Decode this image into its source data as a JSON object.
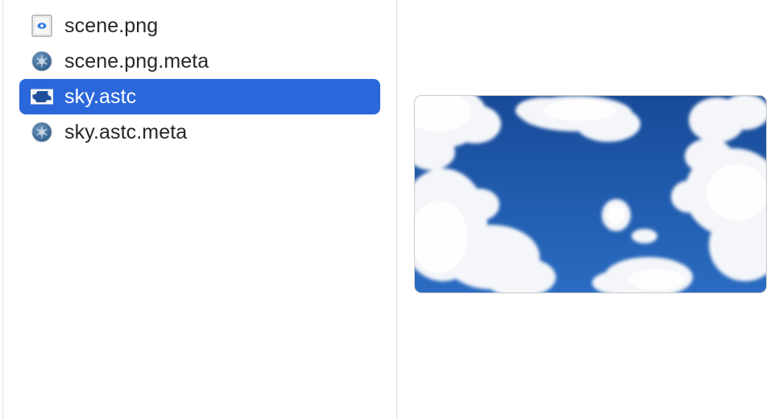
{
  "files": [
    {
      "name": "scene.png",
      "icon": "png-file-icon",
      "selected": false
    },
    {
      "name": "scene.png.meta",
      "icon": "meta-file-icon",
      "selected": false
    },
    {
      "name": "sky.astc",
      "icon": "astc-image-icon",
      "selected": true
    },
    {
      "name": "sky.astc.meta",
      "icon": "meta-file-icon",
      "selected": false
    }
  ],
  "preview": {
    "subject": "sky-with-clouds",
    "sky_color": "#1f5cad",
    "cloud_color": "#f4f6f9"
  },
  "colors": {
    "selection": "#2a67db",
    "text": "#262626",
    "selected_text": "#ffffff",
    "divider": "#dcdcdc"
  }
}
